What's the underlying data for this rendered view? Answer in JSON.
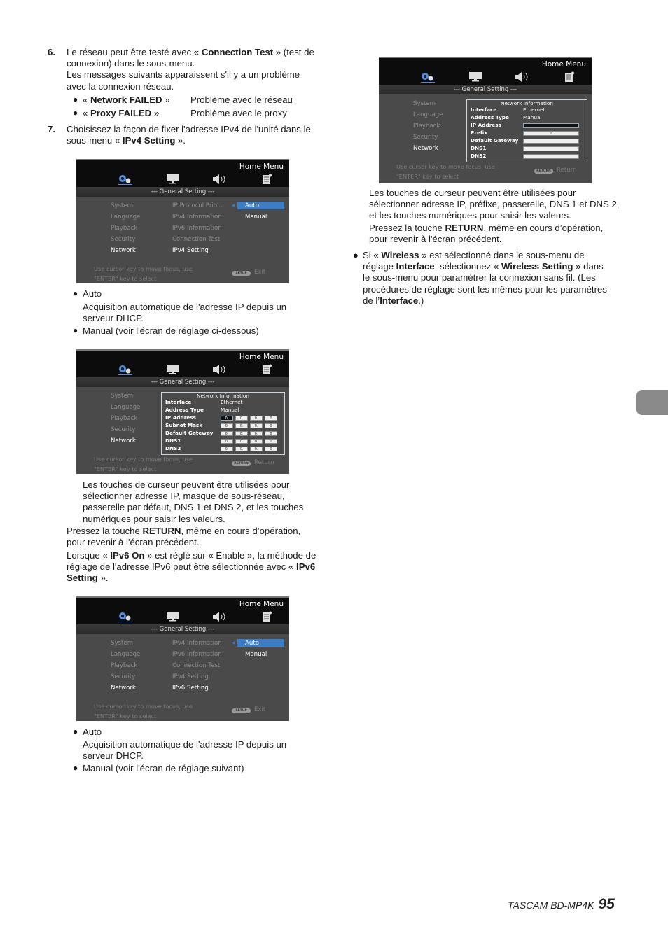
{
  "left": {
    "step6": {
      "number": "6.",
      "lines": [
        [
          "Le réseau peut être testé avec « ",
          {
            "b": "Connection Test"
          },
          " » (test de"
        ],
        [
          "connexion) dans le sous-menu."
        ],
        [
          "Les messages suivants apparaissent s'il y a un problème"
        ],
        [
          "avec la connexion réseau."
        ]
      ],
      "messages": [
        {
          "label": [
            "« ",
            {
              "b": "Network FAILED"
            },
            " »"
          ],
          "desc": "Problème avec le réseau"
        },
        {
          "label": [
            "« ",
            {
              "b": "Proxy FAILED"
            },
            " »"
          ],
          "desc": "Problème avec le proxy"
        }
      ]
    },
    "step7": {
      "number": "7.",
      "lines": [
        [
          "Choisissez la façon de fixer l'adresse IPv4 de l'unité dans le"
        ],
        [
          "sous-menu « ",
          {
            "b": "IPv4 Setting"
          },
          " »."
        ]
      ]
    },
    "ipv4_bullets": {
      "auto": "Auto",
      "auto_desc": [
        [
          "Acquisition automatique de l'adresse IP depuis un"
        ],
        [
          "serveur DHCP."
        ]
      ],
      "manual": "Manual (voir l'écran de réglage ci-dessous)"
    },
    "ipv4_manual_text": [
      [
        "Les touches de curseur peuvent être utilisées pour"
      ],
      [
        "sélectionner adresse IP, masque de sous-réseau,"
      ],
      [
        "passerelle par défaut, DNS 1 et DNS 2, et les touches"
      ],
      [
        "numériques pour saisir les valeurs."
      ]
    ],
    "return_text": [
      [
        "Pressez la touche ",
        {
          "b": "RETURN"
        },
        ", même en cours d’opération,"
      ],
      [
        "pour revenir à l'écran précédent."
      ]
    ],
    "ipv6_text": [
      [
        "Lorsque « ",
        {
          "b": "IPv6 On"
        },
        " » est réglé sur « Enable », la méthode de"
      ],
      [
        "réglage de l'adresse IPv6 peut être sélectionnée avec « ",
        {
          "b": "IPv6"
        }
      ],
      [
        {
          "b": "Setting"
        },
        " »."
      ]
    ],
    "ipv6_bullets": {
      "auto": "Auto",
      "auto_desc": [
        [
          "Acquisition automatique de l'adresse IP depuis un"
        ],
        [
          "serveur DHCP."
        ]
      ],
      "manual": "Manual (voir l'écran de réglage suivant)"
    }
  },
  "right": {
    "ipv6_manual_text": [
      [
        "Les touches de curseur peuvent être utilisées pour"
      ],
      [
        "sélectionner adresse IP, préfixe, passerelle, DNS 1 et DNS 2,"
      ],
      [
        "et les touches numériques pour saisir les valeurs."
      ]
    ],
    "return_text": [
      [
        "Pressez la touche ",
        {
          "b": "RETURN"
        },
        ", même en cours d’opération,"
      ],
      [
        "pour revenir à l'écran précédent."
      ]
    ],
    "wireless_text": [
      [
        "Si « ",
        {
          "b": "Wireless"
        },
        " » est sélectionné dans le sous-menu de"
      ],
      [
        "réglage ",
        {
          "b": "Interface"
        },
        ", sélectionnez « ",
        {
          "b": "Wireless Setting"
        },
        " » dans"
      ],
      [
        "le sous-menu pour paramétrer la connexion sans fil. (Les"
      ],
      [
        "procédures de réglage sont les mêmes pour les paramètres"
      ],
      [
        "de l’",
        {
          "b": "Interface"
        },
        ".)"
      ]
    ]
  },
  "screens": [
    {
      "title": "Home Menu",
      "section": "--- General Setting ---",
      "menu": [
        "System",
        "Language",
        "Playback",
        "Security",
        "Network"
      ],
      "submenu": [
        "IP Protocol Prio...",
        "IPv4 Information",
        "IPv6 Information",
        "Connection Test",
        "IPv4 Setting"
      ],
      "options": [
        "Auto",
        "Manual"
      ],
      "hint": [
        "Use cursor key to move focus, use",
        "\"ENTER\" key to select"
      ],
      "key": "SETUP",
      "key_label": "Exit"
    },
    {
      "title": "Home Menu",
      "section": "--- General Setting ---",
      "menu": [
        "System",
        "Language",
        "Playback",
        "Security",
        "Network"
      ],
      "panel": {
        "title": "Network Information",
        "rows": [
          {
            "label": "Interface",
            "value": "Ethernet"
          },
          {
            "label": "Address Type",
            "value": "Manual"
          },
          {
            "label": "IP Address",
            "octets": [
              "0.",
              "0.",
              "0.",
              "0"
            ]
          },
          {
            "label": "Subnet Mask",
            "octets": [
              "0.",
              "0.",
              "0.",
              "0"
            ]
          },
          {
            "label": "Default Gateway",
            "octets": [
              "0.",
              "0.",
              "0.",
              "0"
            ]
          },
          {
            "label": "DNS1",
            "octets": [
              "0.",
              "0.",
              "0.",
              "0"
            ]
          },
          {
            "label": "DNS2",
            "octets": [
              "0.",
              "0.",
              "0.",
              "0"
            ]
          }
        ]
      },
      "hint": [
        "Use cursor key to move focus, use",
        "\"ENTER\" key to select"
      ],
      "key": "RETURN",
      "key_label": "Return"
    },
    {
      "title": "Home Menu",
      "section": "--- General Setting ---",
      "menu": [
        "System",
        "Language",
        "Playback",
        "Security",
        "Network"
      ],
      "submenu": [
        "IPv4 Information",
        "IPv6 Information",
        "Connection Test",
        "IPv4 Setting",
        "IPv6 Setting"
      ],
      "options": [
        "Auto",
        "Manual"
      ],
      "hint": [
        "Use cursor key to move focus, use",
        "\"ENTER\" key to select"
      ],
      "key": "SETUP",
      "key_label": "Exit"
    },
    {
      "title": "Home Menu",
      "section": "--- General Setting ---",
      "menu": [
        "System",
        "Language",
        "Playback",
        "Security",
        "Network"
      ],
      "panel": {
        "title": "Network Information",
        "rows": [
          {
            "label": "Interface",
            "value": "Ethernet"
          },
          {
            "label": "Address Type",
            "value": "Manual"
          },
          {
            "label": "IP Address",
            "field": ""
          },
          {
            "label": "Prefix",
            "field": "0"
          },
          {
            "label": "Default Gateway",
            "field": ""
          },
          {
            "label": "DNS1",
            "field": ""
          },
          {
            "label": "DNS2",
            "field": ""
          }
        ]
      },
      "hint": [
        "Use cursor key to move focus, use",
        "\"ENTER\" key to select"
      ],
      "key": "RETURN",
      "key_label": "Return"
    }
  ],
  "colors": {
    "highlight": "#3b7dc6",
    "gear_icon": "#4a90e2",
    "side_tab": "#8a8a8a"
  },
  "footer": {
    "product": "TASCAM BD-MP4K",
    "page": "95"
  }
}
